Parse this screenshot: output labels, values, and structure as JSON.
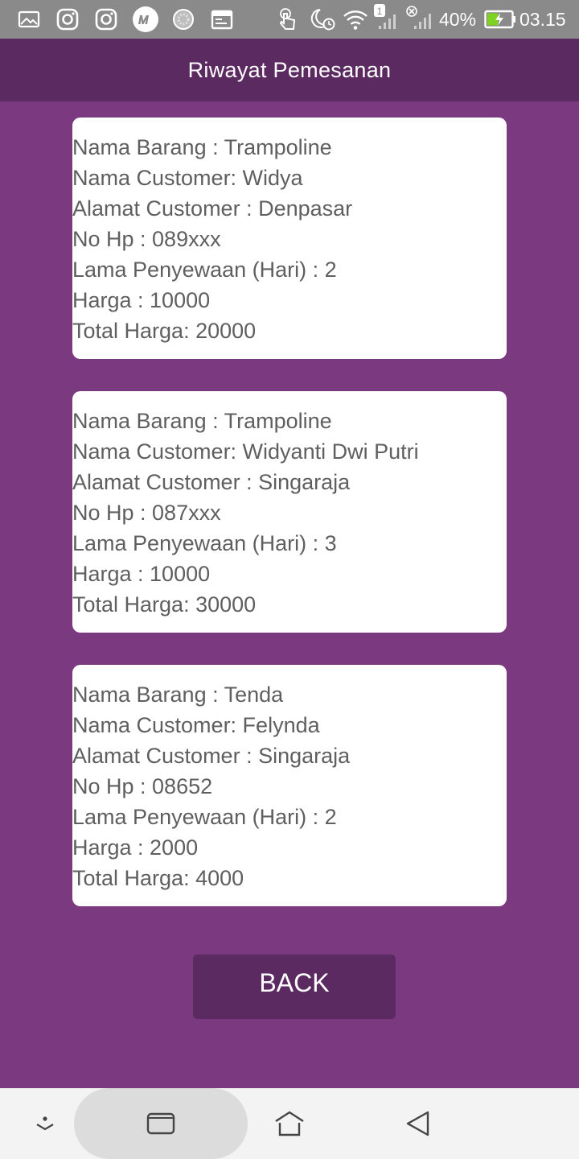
{
  "status_bar": {
    "notification_badge": "1",
    "battery_percent": "40%",
    "time": "03.15",
    "icons": [
      "gallery-icon",
      "instagram-icon",
      "instagram-icon",
      "m-app-icon",
      "loading-icon",
      "calendar-icon",
      "touch-icon",
      "night-alarm-icon",
      "wifi-icon",
      "signal-icon",
      "signal-off-icon",
      "battery-charging-icon"
    ]
  },
  "app_bar": {
    "title": "Riwayat Pemesanan"
  },
  "orders": [
    {
      "lines": [
        "Nama Barang : Trampoline",
        "Nama Customer: Widya",
        "Alamat Customer : Denpasar",
        "No Hp : 089xxx",
        "Lama Penyewaan (Hari) : 2",
        "Harga : 10000",
        "Total Harga: 20000"
      ]
    },
    {
      "lines": [
        "Nama Barang : Trampoline",
        "Nama Customer: Widyanti Dwi Putri",
        "Alamat Customer : Singaraja",
        "No Hp : 087xxx",
        "Lama Penyewaan (Hari) : 3",
        "Harga : 10000",
        "Total Harga: 30000"
      ]
    },
    {
      "lines": [
        "Nama Barang : Tenda",
        "Nama Customer: Felynda",
        "Alamat Customer : Singaraja",
        "No Hp : 08652",
        "Lama Penyewaan (Hari) : 2",
        "Harga : 2000",
        "Total Harga: 4000"
      ]
    }
  ],
  "back_button": {
    "label": "BACK"
  },
  "nav_bar": {
    "icons": [
      "hide-nav-icon",
      "recent-apps-icon",
      "home-icon",
      "back-icon"
    ]
  },
  "colors": {
    "background": "#7b3a80",
    "app_bar": "#5b2a60",
    "status_bar": "#8a8a8a",
    "card": "#ffffff",
    "card_text": "#5f5f5f"
  }
}
